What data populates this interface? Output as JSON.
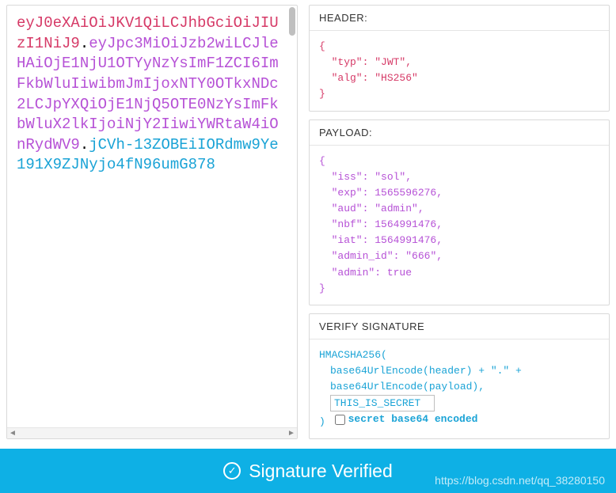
{
  "token": {
    "header": "eyJ0eXAiOiJKV1QiLCJhbGciOiJIUzI1NiJ9",
    "payload": "eyJpc3MiOiJzb2wiLCJleHAiOjE1NjU1OTYyNzYsImF1ZCI6ImFkbWluIiwibmJmIjoxNTY0OTkxNDc2LCJpYXQiOjE1NjQ5OTE0NzYsImFkbWluX2lkIjoiNjY2IiwiYWRtaW4iOnRydWV9",
    "signature": "jCVh-13ZOBEiIORdmw9Ye191X9ZJNyjo4fN96umG878"
  },
  "sections": {
    "header_title": "HEADER:",
    "payload_title": "PAYLOAD:",
    "verify_title": "VERIFY SIGNATURE"
  },
  "header_decoded": {
    "typ": "JWT",
    "alg": "HS256"
  },
  "payload_decoded": {
    "iss": "sol",
    "exp": 1565596276,
    "aud": "admin",
    "nbf": 1564991476,
    "iat": 1564991476,
    "admin_id": "666",
    "admin": true
  },
  "signature_block": {
    "func": "HMACSHA256(",
    "line1": "base64UrlEncode(header) + \".\" +",
    "line2": "base64UrlEncode(payload),",
    "secret_value": "THIS_IS_SECRET",
    "close": ")",
    "checkbox_label": "secret base64 encoded",
    "checkbox_checked": false
  },
  "verified": {
    "text": "Signature Verified"
  },
  "watermark": "https://blog.csdn.net/qq_38280150"
}
